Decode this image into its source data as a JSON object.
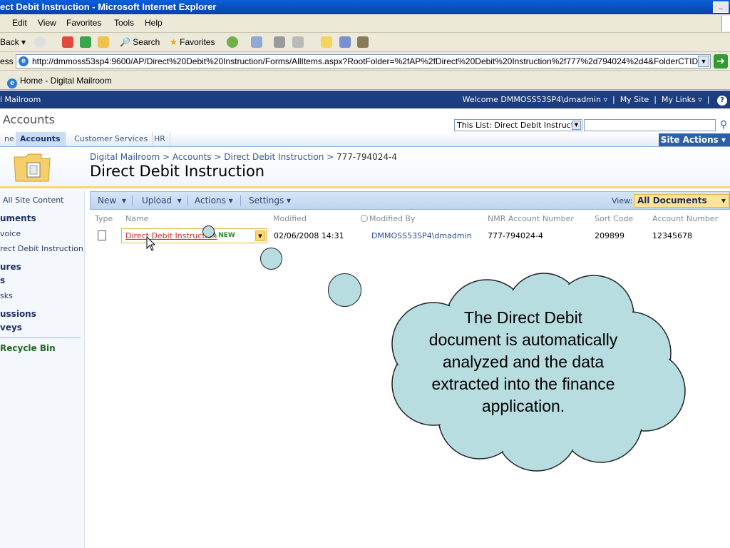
{
  "browser": {
    "title": "ect Debit Instruction - Microsoft Internet Explorer",
    "menu": [
      "Edit",
      "View",
      "Favorites",
      "Tools",
      "Help"
    ],
    "toolbar": {
      "back": "Back",
      "search": "Search",
      "favorites": "Favorites"
    },
    "address_label": "ess",
    "address_url": "http://dmmoss53sp4:9600/AP/Direct%20Debit%20Instruction/Forms/AllItems.aspx?RootFolder=%2fAP%2fDirect%20Debit%20Instruction%2f777%2d794024%2d4&FolderCTID=",
    "tab_title": "Home - Digital Mailroom"
  },
  "sharepoint": {
    "global_left": "l Mailroom",
    "welcome": "Welcome DMMOSS53SP4\\dmadmin",
    "my_site": "My Site",
    "my_links": "My Links",
    "site_title": "Accounts",
    "search_scope": "This List: Direct Debit Instructio",
    "nav_tabs": [
      "ne",
      "Accounts",
      "Customer Services",
      "HR"
    ],
    "site_actions": "Site Actions",
    "breadcrumb": [
      "Digital Mailroom",
      "Accounts",
      "Direct Debit Instruction",
      "777-794024-4"
    ],
    "page_title": "Direct Debit Instruction",
    "quicklaunch": [
      {
        "label": "All Site Content",
        "heading": false
      },
      {
        "label": "uments",
        "heading": true
      },
      {
        "label": "voice",
        "heading": false
      },
      {
        "label": "rect Debit Instruction",
        "heading": false
      },
      {
        "label": "ures",
        "heading": true
      },
      {
        "label": "s",
        "heading": true
      },
      {
        "label": "sks",
        "heading": false
      },
      {
        "label": "ussions",
        "heading": true
      },
      {
        "label": "veys",
        "heading": true
      }
    ],
    "recycle_bin": "Recycle Bin",
    "list_toolbar": {
      "new": "New",
      "upload": "Upload",
      "actions": "Actions",
      "settings": "Settings",
      "view_label": "View:",
      "view_value": "All Documents"
    },
    "columns": [
      "Type",
      "Name",
      "Modified",
      "Modified By",
      "NMR Account Number",
      "Sort Code",
      "Account Number"
    ],
    "rows": [
      {
        "name": "Direct Debit Instruction",
        "badge": "! NEW",
        "modified": "02/06/2008 14:31",
        "modified_by": "DMMOSS53SP4\\dmadmin",
        "nmr_account": "777-794024-4",
        "sort_code": "209899",
        "account_number": "12345678"
      }
    ]
  },
  "callout": {
    "text": "The Direct Debit document is automatically analyzed and the data extracted into the finance application."
  },
  "colors": {
    "sp_blue": "#1c3d7f",
    "cloud_fill": "#b7dde1",
    "view_highlight": "#ffe49a"
  }
}
